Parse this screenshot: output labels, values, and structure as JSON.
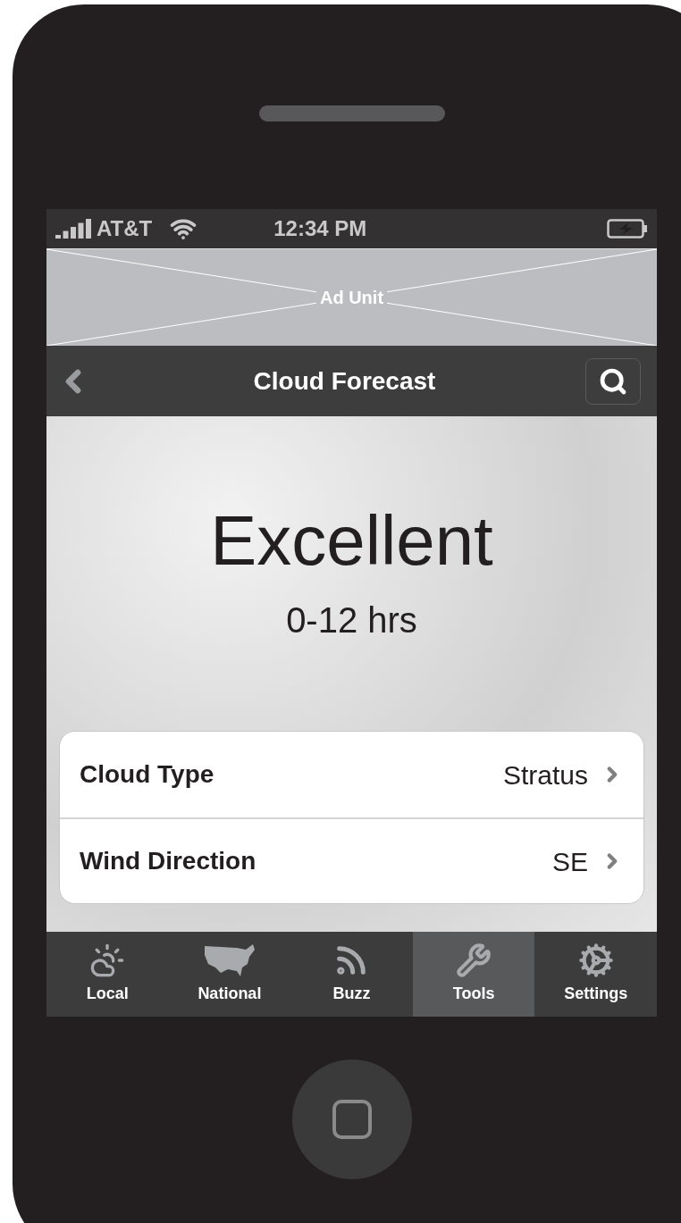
{
  "status_bar": {
    "carrier": "AT&T",
    "time": "12:34 PM"
  },
  "ad": {
    "label": "Ad Unit"
  },
  "nav_bar": {
    "title": "Cloud Forecast"
  },
  "forecast": {
    "rating": "Excellent",
    "range": "0-12 hrs"
  },
  "details": [
    {
      "label": "Cloud Type",
      "value": "Stratus"
    },
    {
      "label": "Wind Direction",
      "value": "SE"
    }
  ],
  "tabs": [
    {
      "kind": "local",
      "label": "Local",
      "selected": false
    },
    {
      "kind": "national",
      "label": "National",
      "selected": false
    },
    {
      "kind": "buzz",
      "label": "Buzz",
      "selected": false
    },
    {
      "kind": "tools",
      "label": "Tools",
      "selected": true
    },
    {
      "kind": "settings",
      "label": "Settings",
      "selected": false
    }
  ]
}
